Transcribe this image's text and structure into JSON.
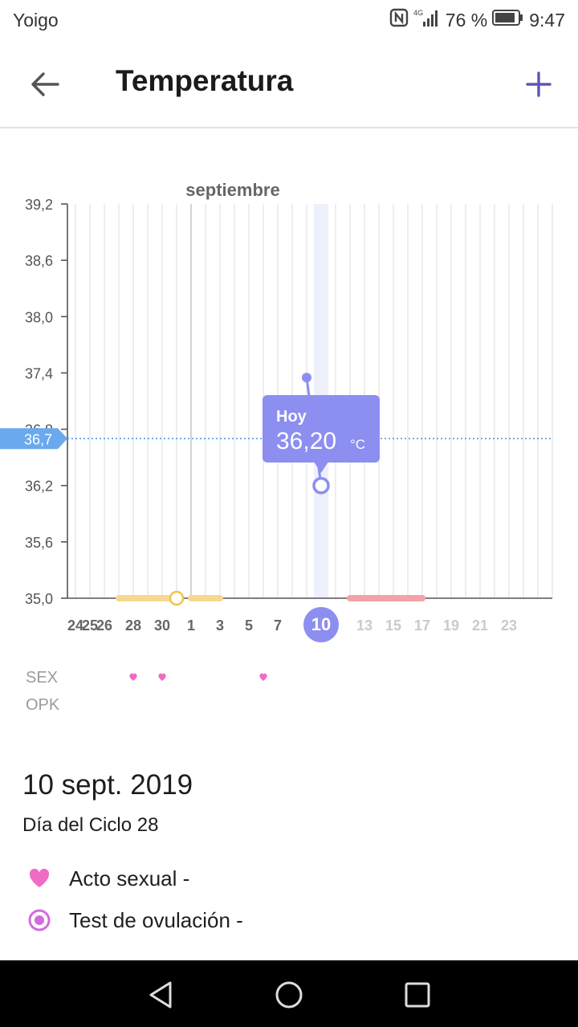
{
  "status_bar": {
    "carrier": "Yoigo",
    "battery": "76 %",
    "time": "9:47",
    "network": "4G"
  },
  "app_bar": {
    "title": "Temperatura"
  },
  "chart_data": {
    "type": "line",
    "title": "septiembre",
    "y_ticks": [
      "39,2",
      "38,6",
      "38,0",
      "37,4",
      "36,8",
      "36,2",
      "35,6",
      "35,0"
    ],
    "ylim": [
      35.0,
      39.2
    ],
    "x_tick_labels": [
      "24",
      "26",
      "28",
      "30",
      "1",
      "3",
      "5",
      "7",
      "10",
      "13",
      "15",
      "17",
      "19",
      "21",
      "23",
      "25"
    ],
    "selected_day": "10",
    "points": [
      {
        "day": "9 sept.",
        "value": 37.35
      },
      {
        "day": "10 sept.",
        "value": 36.2
      }
    ],
    "coverline": {
      "label": "36,7",
      "value": 36.7
    },
    "tooltip": {
      "label": "Hoy",
      "value": "36,20",
      "unit": "°C"
    },
    "period_bars": [
      {
        "from": "27 ago.",
        "to": "31 ago.",
        "color": "#f7d88e"
      },
      {
        "from": "1 sept.",
        "to": "3 sept.",
        "color": "#f7d88e"
      },
      {
        "from": "12 sept.",
        "to": "17 sept.",
        "color": "#f3a2a8"
      }
    ],
    "ovulation_marker": {
      "day": "31 ago."
    },
    "rows": [
      {
        "label": "SEX",
        "days": [
          "28 ago.",
          "30 ago.",
          "6 sept."
        ]
      },
      {
        "label": "OPK",
        "days": []
      }
    ],
    "colors": {
      "accent": "#8c8ef0",
      "heart": "#f06cc4",
      "grid": "#e6e6ea"
    }
  },
  "detail": {
    "date": "10 sept. 2019",
    "cycle": "Día del Ciclo 28",
    "items": [
      {
        "icon": "heart-icon",
        "label": "Acto sexual -"
      },
      {
        "icon": "target-icon",
        "label": "Test de ovulación -"
      }
    ]
  },
  "nav_bar": {
    "back": "back-nav",
    "home": "home-nav",
    "recents": "recents-nav"
  }
}
